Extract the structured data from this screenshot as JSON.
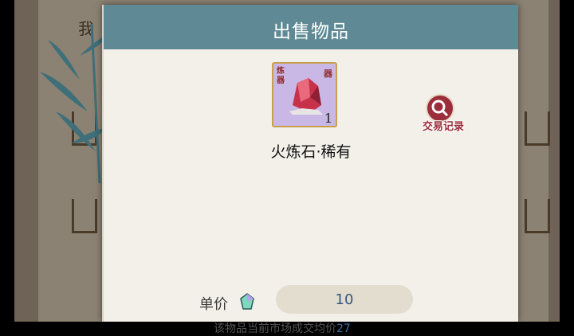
{
  "background": {
    "label": "我"
  },
  "dialog": {
    "title": "出售物品",
    "item": {
      "name": "火炼石·稀有",
      "count": "1",
      "tag_left": "炼器",
      "tag_right": "器"
    },
    "trade_record": {
      "label": "交易记录",
      "icon": "search-icon"
    },
    "price": {
      "label": "单价",
      "currency_icon": "gem-icon",
      "value": "10"
    },
    "hint_prefix": "该物品当前市场成交均价",
    "hint_value": "27"
  },
  "colors": {
    "header": "#5f8a95",
    "panel": "#f2f0e9",
    "accent": "#9c2d3a",
    "price_text": "#33577e"
  }
}
